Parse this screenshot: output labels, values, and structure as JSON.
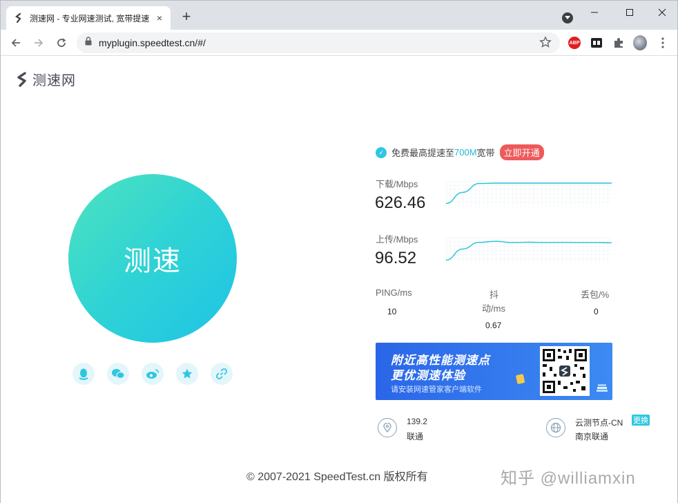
{
  "browser": {
    "tab_title": "测速网 - 专业网速测试, 宽带提速",
    "tab_close": "×",
    "new_tab": "+",
    "url": "myplugin.speedtest.cn/#/",
    "ext_abp": "ABP"
  },
  "page": {
    "logo_text": "测速网",
    "start_button": "测速",
    "promo": {
      "prefix": "免费最高提速至",
      "highlight": "700M",
      "suffix": "宽带",
      "button": "立即开通"
    },
    "download": {
      "label": "下载/Mbps",
      "value": "626.46",
      "trend": [
        0.05,
        0.55,
        0.95,
        0.97,
        0.97,
        0.97,
        0.97,
        0.97,
        0.97,
        0.97,
        0.97
      ]
    },
    "upload": {
      "label": "上传/Mbps",
      "value": "96.52",
      "trend": [
        0.05,
        0.55,
        0.85,
        0.9,
        0.84,
        0.86,
        0.84,
        0.85,
        0.84,
        0.84,
        0.83
      ]
    },
    "ping": {
      "label": "PING/ms",
      "value": "10"
    },
    "jitter": {
      "label_line1": "抖",
      "label_line2": "动/ms",
      "value": "0.67"
    },
    "loss": {
      "label": "丢包/%",
      "value": "0"
    },
    "banner": {
      "line1": "附近高性能测速点",
      "line2": "更优测速体验",
      "line3": "请安装网速管家客户端软件"
    },
    "client": {
      "ip": "139.2",
      "isp": "联通"
    },
    "node": {
      "name": "云测节点-CN",
      "change": "更换",
      "location": "南京联通"
    },
    "footer": "© 2007-2021 SpeedTest.cn 版权所有",
    "watermark": "知乎 @williamxin"
  }
}
